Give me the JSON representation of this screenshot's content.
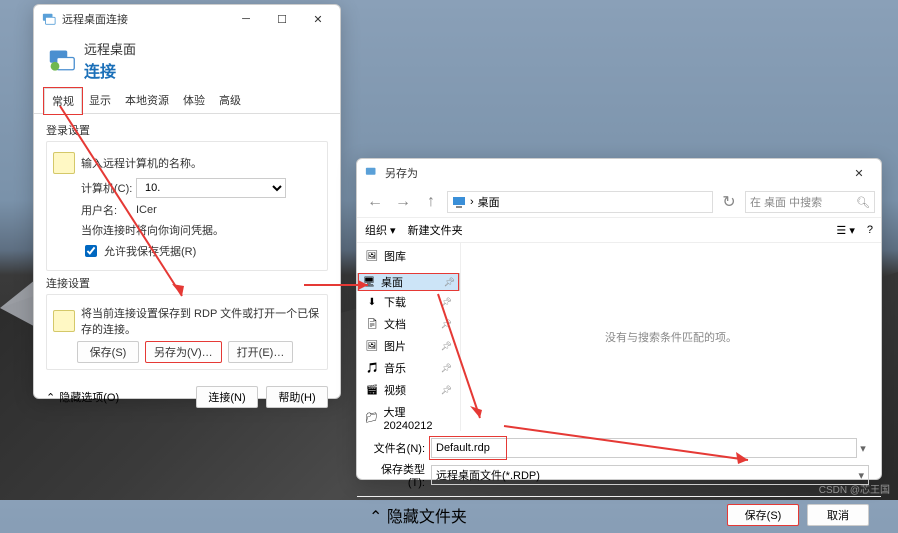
{
  "rdp": {
    "window_title": "远程桌面连接",
    "header_title": "远程桌面",
    "header_sub": "连接",
    "tabs": [
      "常规",
      "显示",
      "本地资源",
      "体验",
      "高级"
    ],
    "login_section": "登录设置",
    "login_prompt": "输入远程计算机的名称。",
    "computer_label": "计算机(C):",
    "computer_value": "10.",
    "user_label": "用户名:",
    "user_value": "ICer",
    "cred_hint": "当你连接时将向你询问凭据。",
    "allow_save": "允许我保存凭据(R)",
    "conn_section": "连接设置",
    "conn_hint": "将当前连接设置保存到 RDP 文件或打开一个已保存的连接。",
    "btn_save": "保存(S)",
    "btn_saveas": "另存为(V)…",
    "btn_open": "打开(E)…",
    "hide_opts": "隐藏选项(O)",
    "btn_connect": "连接(N)",
    "btn_help": "帮助(H)"
  },
  "saveas": {
    "window_title": "另存为",
    "path_label": "桌面",
    "search_placeholder": "在 桌面 中搜索",
    "organize": "组织",
    "new_folder": "新建文件夹",
    "empty_msg": "没有与搜索条件匹配的项。",
    "side": [
      {
        "icon": "gallery",
        "label": "图库"
      },
      {
        "icon": "desktop",
        "label": "桌面",
        "sel": true,
        "pin": true
      },
      {
        "icon": "download",
        "label": "下载",
        "pin": true
      },
      {
        "icon": "doc",
        "label": "文档",
        "pin": true
      },
      {
        "icon": "pic",
        "label": "图片",
        "pin": true
      },
      {
        "icon": "music",
        "label": "音乐",
        "pin": true
      },
      {
        "icon": "video",
        "label": "视频",
        "pin": true
      },
      {
        "icon": "folder",
        "label": "大理20240212"
      }
    ],
    "filename_label": "文件名(N):",
    "filename_value": "Default.rdp",
    "filetype_label": "保存类型(T):",
    "filetype_value": "远程桌面文件(*.RDP)",
    "hide_folders": "隐藏文件夹",
    "btn_save": "保存(S)",
    "btn_cancel": "取消"
  },
  "watermark": "CSDN @芯王国"
}
